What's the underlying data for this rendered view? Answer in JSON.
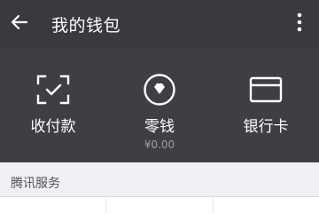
{
  "header": {
    "title": "我的钱包",
    "back_icon": "arrow-left-icon",
    "more_icon": "more-vertical-icon"
  },
  "wallet": {
    "items": [
      {
        "label": "收付款",
        "icon": "scan-pay-icon"
      },
      {
        "label": "零钱",
        "sub": "¥0.00",
        "icon": "change-diamond-icon"
      },
      {
        "label": "银行卡",
        "icon": "bank-card-icon"
      }
    ]
  },
  "services": {
    "title": "腾讯服务"
  },
  "colors": {
    "header_bg": "#393a3f",
    "wallet_bg": "#3e3f44",
    "section_bg": "#efeff4",
    "sub_text": "#9d9ea2"
  }
}
